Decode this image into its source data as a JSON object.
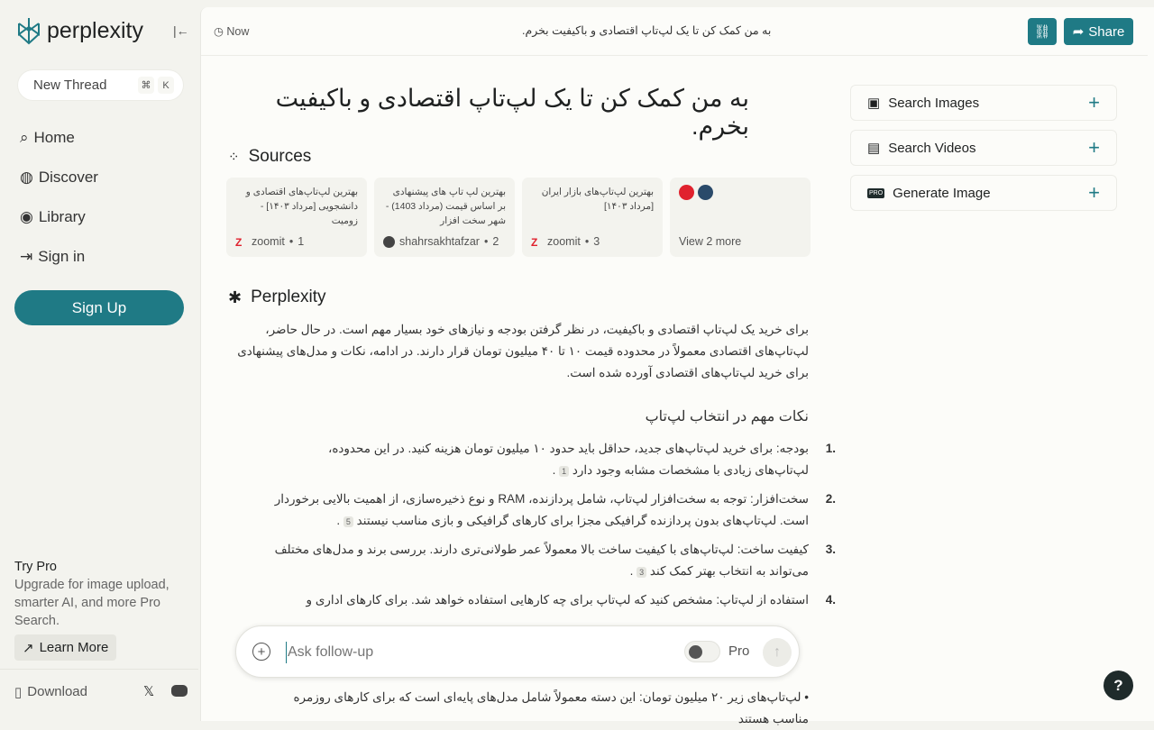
{
  "brand": {
    "name": "perplexity",
    "accent": "#1f7a85"
  },
  "sidebar": {
    "new_thread": "New Thread",
    "kbd": [
      "⌘",
      "K"
    ],
    "items": [
      {
        "label": "Home",
        "icon": "home-search-icon"
      },
      {
        "label": "Discover",
        "icon": "globe-icon"
      },
      {
        "label": "Library",
        "icon": "library-icon"
      },
      {
        "label": "Sign in",
        "icon": "sign-in-icon"
      }
    ],
    "signup": "Sign Up",
    "try_pro_title": "Try Pro",
    "try_pro_text": "Upgrade for image upload, smarter AI, and more Pro Search.",
    "learn_more": "Learn More",
    "download": "Download"
  },
  "header": {
    "time": "Now",
    "title": "به من کمک کن تا یک لپ‌تاپ اقتصادی و باکیفیت بخرم.",
    "share": "Share"
  },
  "question": "به من کمک کن تا یک لپ‌تاپ اقتصادی و باکیفیت بخرم.",
  "sources": {
    "title": "Sources",
    "cards": [
      {
        "title": "بهترین لپ‌تاپ‌های اقتصادی و دانشجویی [مرداد ۱۴۰۳] - زومیت",
        "site": "zoomit",
        "index": "1"
      },
      {
        "title": "بهترین لپ تاپ های پیشنهادی بر اساس قیمت (مرداد 1403) - شهر سخت افزار",
        "site": "shahrsakhtafzar",
        "index": "2"
      },
      {
        "title": "بهترین لپ‌تاپ‌های بازار ایران [مرداد ۱۴۰۳]",
        "site": "zoomit",
        "index": "3"
      }
    ],
    "more": "View 2 more"
  },
  "answer": {
    "title": "Perplexity",
    "intro": "برای خرید یک لپ‌تاپ اقتصادی و باکیفیت، در نظر گرفتن بودجه و نیازهای خود بسیار مهم است. در حال حاضر، لپ‌تاپ‌های اقتصادی معمولاً در محدوده قیمت ۱۰ تا ۴۰ میلیون تومان قرار دارند. در ادامه، نکات و مدل‌های پیشنهادی برای خرید لپ‌تاپ‌های اقتصادی آورده شده است.",
    "heading": "نکات مهم در انتخاب لپ‌تاپ",
    "items": [
      {
        "n": "1.",
        "text": "بودجه: برای خرید لپ‌تاپ‌های جدید، حداقل باید حدود ۱۰ میلیون تومان هزینه کنید. در این محدوده، لپ‌تاپ‌های زیادی با مشخصات مشابه وجود دارد",
        "cite": "1"
      },
      {
        "n": "2.",
        "text": "سخت‌افزار: توجه به سخت‌افزار لپ‌تاپ، شامل پردازنده، RAM و نوع ذخیره‌سازی، از اهمیت بالایی برخوردار است. لپ‌تاپ‌های بدون پردازنده گرافیکی مجزا برای کارهای گرافیکی و بازی مناسب نیستند",
        "cite": "5"
      },
      {
        "n": "3.",
        "text": "کیفیت ساخت: لپ‌تاپ‌های با کیفیت ساخت بالا معمولاً عمر طولانی‌تری دارند. بررسی برند و مدل‌های مختلف می‌تواند به انتخاب بهتر کمک کند",
        "cite": "3"
      },
      {
        "n": "4.",
        "text": "استفاده از لپ‌تاپ: مشخص کنید که لپ‌تاپ برای چه کارهایی استفاده خواهد شد. برای کارهای اداری و",
        "cite": ""
      }
    ],
    "bullet": "لپ‌تاپ‌های زیر ۲۰ میلیون تومان: این دسته معمولاً شامل مدل‌های پایه‌ای است که برای کارهای روزمره مناسب هستند"
  },
  "ask": {
    "placeholder": "Ask follow-up",
    "pro": "Pro",
    "pro_enabled": false
  },
  "right": {
    "items": [
      {
        "label": "Search Images",
        "icon": "image-icon"
      },
      {
        "label": "Search Videos",
        "icon": "film-icon"
      },
      {
        "label": "Generate Image",
        "icon": "pro-badge-icon"
      }
    ]
  },
  "help": "?"
}
